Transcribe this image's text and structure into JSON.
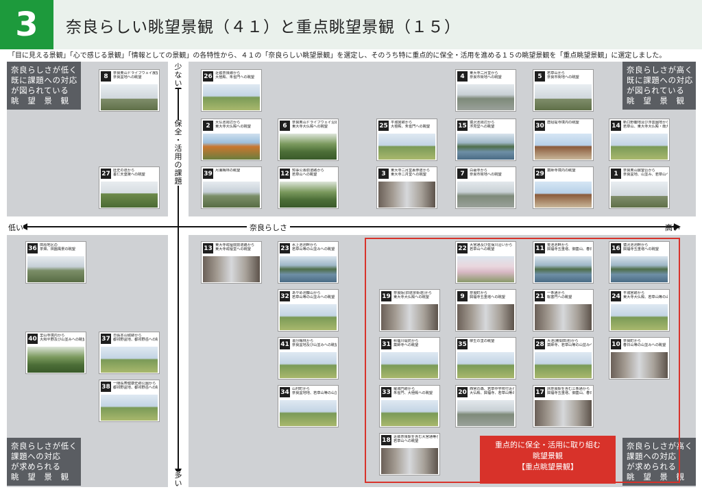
{
  "header": {
    "number": "3",
    "title": "奈良らしい眺望景観（４１）と重点眺望景観（１５）"
  },
  "intro": "「目に見える景観」「心で感じる景観」「情報としての景観」の各特性から、４１の「奈良らしい眺望景観」を選定し、そのうち特に重点的に保全・活用を進める１５の眺望景観を「重点眺望景観」に選定しました。",
  "axes": {
    "top": "少ない",
    "bottom": "多い",
    "left": "低い",
    "right": "高い",
    "horizontal": "奈良らしさ",
    "vertical": "保全・活用の課題"
  },
  "corners": {
    "tl": "奈良らしさが低く\n既に課題への対応\nが図られている\n眺　望　景　観",
    "tr": "奈良らしさが高く\n既に課題への対応\nが図られている\n眺　望　景　観",
    "bl": "奈良らしさが低く\n課題への対応\nが求められる\n眺　望　景　観",
    "br": "奈良らしさが高く\n課題への対応\nが求められる\n眺　望　景　観"
  },
  "priority_label": "重点的に保全・活用に取り組む\n眺望景観\n【重点眺望景観】",
  "colors": {
    "green": "#1d9a3c",
    "red": "#d8322a",
    "quadrant": "#cfd1d4",
    "corner": "#5a5d62"
  },
  "cards": [
    {
      "num": "8",
      "cap": "奈良奥山ドライブウェイ展望所から\n奈良盆地への眺望",
      "photo": "sky"
    },
    {
      "num": "27",
      "cap": "歴史の道から\n垂仁天皇陵への眺望",
      "photo": "mound"
    },
    {
      "num": "26",
      "cap": "近鉄奈良線から\n大極殿、朱雀門への眺望",
      "photo": "field"
    },
    {
      "num": "4",
      "cap": "東大寺二月堂から\n奈良市街地への眺望",
      "photo": "city"
    },
    {
      "num": "5",
      "cap": "若草山から\n奈良市街地への眺望",
      "photo": "sky"
    },
    {
      "num": "2",
      "cap": "大仏池周辺から\n東大寺大仏殿への眺望",
      "photo": "autumn"
    },
    {
      "num": "6",
      "cap": "奈良奥山ドライブウェイ沿道（鶯の滝付近）から\n東大寺大仏殿への眺望",
      "photo": "forest"
    },
    {
      "num": "25",
      "cap": "平城宮跡から\n大極殿、朱雀門への眺望",
      "photo": "field"
    },
    {
      "num": "15",
      "cap": "猿沢池周辺から\n浮見堂への眺望",
      "photo": "pond"
    },
    {
      "num": "30",
      "cap": "唐招提寺境内の眺望",
      "photo": "temple"
    },
    {
      "num": "14",
      "cap": "新口野鹿地及び浮雲園地から\n若草山、東大寺大仏殿・南大門への眺望",
      "photo": "field"
    },
    {
      "num": "39",
      "cap": "月瀬梅林の眺望",
      "photo": "hill"
    },
    {
      "num": "12",
      "cap": "知事公舎前道路から\n若草山への眺望",
      "photo": "forest"
    },
    {
      "num": "3",
      "cap": "東大寺二月堂裏参道から\n東大寺二月堂への眺望",
      "photo": "street"
    },
    {
      "num": "7",
      "cap": "白毫寺から\n奈良市街地への眺望",
      "photo": "city"
    },
    {
      "num": "29",
      "cap": "薬師寺境内の眺望",
      "photo": "temple"
    },
    {
      "num": "1",
      "cap": "奈良奥山展望台から\n奈良盆地、山並み、若草山への眺望",
      "photo": "sky"
    },
    {
      "num": "36",
      "cap": "田原地区の\n茶畑、田園風景の眺望",
      "photo": "hill"
    },
    {
      "num": "40",
      "cap": "里山寺境内から\n大和平野及び山並みへの眺望",
      "photo": "forest"
    },
    {
      "num": "37",
      "cap": "日張本山城跡から\n都祁野盆地、都祁野岳への眺望",
      "photo": "field"
    },
    {
      "num": "38",
      "cap": "一陵長寿健康史跡公園から\n都祁野盆地、都祁野岳への眺望",
      "photo": "field"
    },
    {
      "num": "13",
      "cap": "東大寺戒壇院前道路から\n東大寺戒壇堂への眺望",
      "photo": "street"
    },
    {
      "num": "23",
      "cap": "水上池池畔から\n若草山等の山並みへの眺望",
      "photo": "pond"
    },
    {
      "num": "32",
      "cap": "あやめ池藤山から\n若草山等の山並みへの眺望",
      "photo": "field"
    },
    {
      "num": "41",
      "cap": "追分梅林から\n奈良盆地及び山並みへの眺望",
      "photo": "field"
    },
    {
      "num": "34",
      "cap": "山村町から\n奈良盆地地、若草山等の山並みへの眺望",
      "photo": "field"
    },
    {
      "num": "22",
      "cap": "大宮通及び佐保川沿いから\n若草山への眺望",
      "photo": "blossom"
    },
    {
      "num": "11",
      "cap": "荒池池畔から\n興福寺五重塔、御蓋山、春日山への眺望",
      "photo": "pond"
    },
    {
      "num": "16",
      "cap": "猿沢池池畔から\n興福寺五重塔への眺望",
      "photo": "pond"
    },
    {
      "num": "19",
      "cap": "奈良阪(旧道京街道)から\n東大寺大仏殿への眺望",
      "photo": "street"
    },
    {
      "num": "9",
      "cap": "奈良町から\n興福寺五重塔への眺望",
      "photo": "street"
    },
    {
      "num": "21",
      "cap": "一条通から\n転害門への眺望",
      "photo": "street"
    },
    {
      "num": "24",
      "cap": "平城宮跡から\n東大寺大仏殿、若草山等の山並みへの眺望",
      "photo": "field"
    },
    {
      "num": "31",
      "cap": "秋篠川堤防から\n薬師寺への眺望",
      "photo": "field"
    },
    {
      "num": "35",
      "cap": "柳生の里の眺望",
      "photo": "field"
    },
    {
      "num": "28",
      "cap": "大池(勝間田池)から\n薬師寺、若草山等の山並みへの眺望",
      "photo": "field"
    },
    {
      "num": "10",
      "cap": "奈良町から\n春日山等の山並みへの眺望",
      "photo": "street"
    },
    {
      "num": "33",
      "cap": "羅城門跡から\n朱雀門、大極殿への眺望",
      "photo": "field"
    },
    {
      "num": "20",
      "cap": "西宮の森、若草中学校付近から\n大仏殿、興福寺、若草山等の山並みへの眺望",
      "photo": "city"
    },
    {
      "num": "17",
      "cap": "JR奈良駅を含む三条通から\n興福寺五重塔、御蓋山、春日山への眺望",
      "photo": "street"
    },
    {
      "num": "18",
      "cap": "近鉄奈良駅を含む大宮通等から\n若草山への眺望",
      "photo": "street"
    }
  ]
}
